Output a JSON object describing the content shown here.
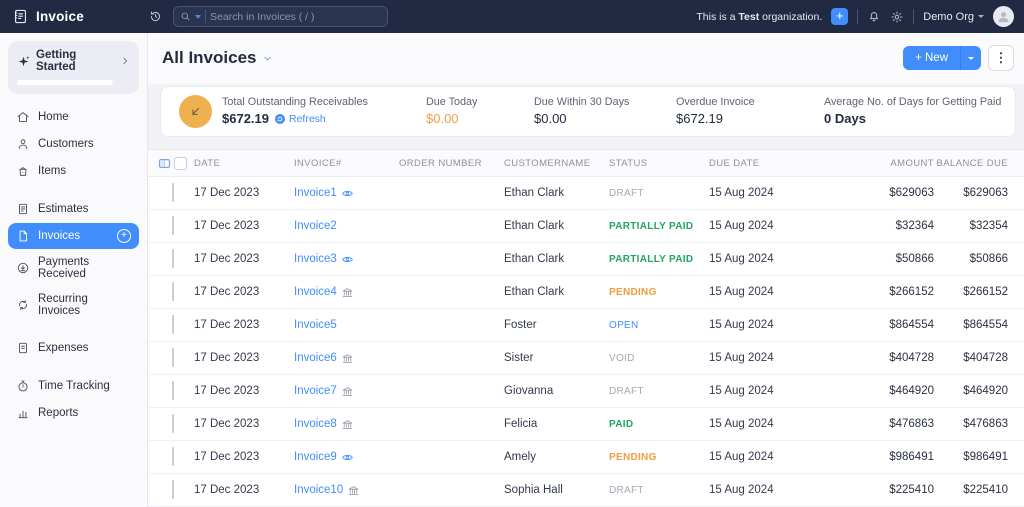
{
  "topbar": {
    "app_name": "Invoice",
    "search_placeholder": "Search in Invoices ( / )",
    "org_note_prefix": "This is a ",
    "org_note_bold": "Test",
    "org_note_suffix": " organization.",
    "org_name": "Demo Org"
  },
  "sidebar": {
    "getting_started": "Getting Started",
    "items": [
      {
        "label": "Home"
      },
      {
        "label": "Customers"
      },
      {
        "label": "Items"
      },
      {
        "label": "Estimates"
      },
      {
        "label": "Invoices"
      },
      {
        "label": "Payments Received"
      },
      {
        "label": "Recurring Invoices"
      },
      {
        "label": "Expenses"
      },
      {
        "label": "Time Tracking"
      },
      {
        "label": "Reports"
      }
    ],
    "active_item": "Invoices"
  },
  "page_header": {
    "title": "All Invoices",
    "new_label": "+ New"
  },
  "summary": {
    "receivables_label": "Total Outstanding Receivables",
    "receivables_value": "$672.19",
    "refresh_label": "Refresh",
    "cards": [
      {
        "label": "Due Today",
        "value": "$0.00",
        "tone": "orange"
      },
      {
        "label": "Due Within 30 Days",
        "value": "$0.00",
        "tone": "plain"
      },
      {
        "label": "Overdue Invoice",
        "value": "$672.19",
        "tone": "plain"
      },
      {
        "label": "Average No. of Days for Getting Paid",
        "value": "0 Days",
        "tone": "bold"
      }
    ]
  },
  "table": {
    "columns": [
      "DATE",
      "INVOICE#",
      "ORDER NUMBER",
      "CUSTOMERNAME",
      "STATUS",
      "DUE DATE",
      "AMOUNT",
      "BALANCE DUE"
    ],
    "rows": [
      {
        "date": "17 Dec 2023",
        "invoice": "Invoice1",
        "icon": "eye",
        "order": "",
        "customer": "Ethan Clark",
        "status": "DRAFT",
        "tone": "muted",
        "due": "15 Aug 2024",
        "amount": "$629063",
        "balance": "$629063"
      },
      {
        "date": "17 Dec 2023",
        "invoice": "Invoice2",
        "icon": "",
        "order": "",
        "customer": "Ethan Clark",
        "status": "PARTIALLY PAID",
        "tone": "green",
        "due": "15 Aug 2024",
        "amount": "$32364",
        "balance": "$32354"
      },
      {
        "date": "17 Dec 2023",
        "invoice": "Invoice3",
        "icon": "eye",
        "order": "",
        "customer": "Ethan Clark",
        "status": "PARTIALLY PAID",
        "tone": "green",
        "due": "15 Aug 2024",
        "amount": "$50866",
        "balance": "$50866"
      },
      {
        "date": "17 Dec 2023",
        "invoice": "Invoice4",
        "icon": "bank",
        "order": "",
        "customer": "Ethan Clark",
        "status": "PENDING",
        "tone": "orange",
        "due": "15 Aug 2024",
        "amount": "$266152",
        "balance": "$266152"
      },
      {
        "date": "17 Dec 2023",
        "invoice": "Invoice5",
        "icon": "",
        "order": "",
        "customer": "Foster",
        "status": "OPEN",
        "tone": "blue",
        "due": "15 Aug 2024",
        "amount": "$864554",
        "balance": "$864554"
      },
      {
        "date": "17 Dec 2023",
        "invoice": "Invoice6",
        "icon": "bank",
        "order": "",
        "customer": "Sister",
        "status": "VOID",
        "tone": "muted",
        "due": "15 Aug 2024",
        "amount": "$404728",
        "balance": "$404728"
      },
      {
        "date": "17 Dec 2023",
        "invoice": "Invoice7",
        "icon": "bank",
        "order": "",
        "customer": "Giovanna",
        "status": "DRAFT",
        "tone": "muted",
        "due": "15 Aug 2024",
        "amount": "$464920",
        "balance": "$464920"
      },
      {
        "date": "17 Dec 2023",
        "invoice": "Invoice8",
        "icon": "bank",
        "order": "",
        "customer": "Felicia",
        "status": "PAID",
        "tone": "green",
        "due": "15 Aug 2024",
        "amount": "$476863",
        "balance": "$476863"
      },
      {
        "date": "17 Dec 2023",
        "invoice": "Invoice9",
        "icon": "eye",
        "order": "",
        "customer": "Amely",
        "status": "PENDING",
        "tone": "orange",
        "due": "15 Aug 2024",
        "amount": "$986491",
        "balance": "$986491"
      },
      {
        "date": "17 Dec 2023",
        "invoice": "Invoice10",
        "icon": "bank",
        "order": "",
        "customer": "Sophia Hall",
        "status": "DRAFT",
        "tone": "muted",
        "due": "15 Aug 2024",
        "amount": "$225410",
        "balance": "$225410"
      }
    ]
  },
  "colors": {
    "accent": "#408dfb",
    "topbar_bg": "#212a42",
    "status_green": "#21a463",
    "status_orange": "#ef9d3e",
    "status_muted": "#a4a9b4",
    "warning_orange": "#efa041",
    "receivable_circle": "#efb050"
  }
}
